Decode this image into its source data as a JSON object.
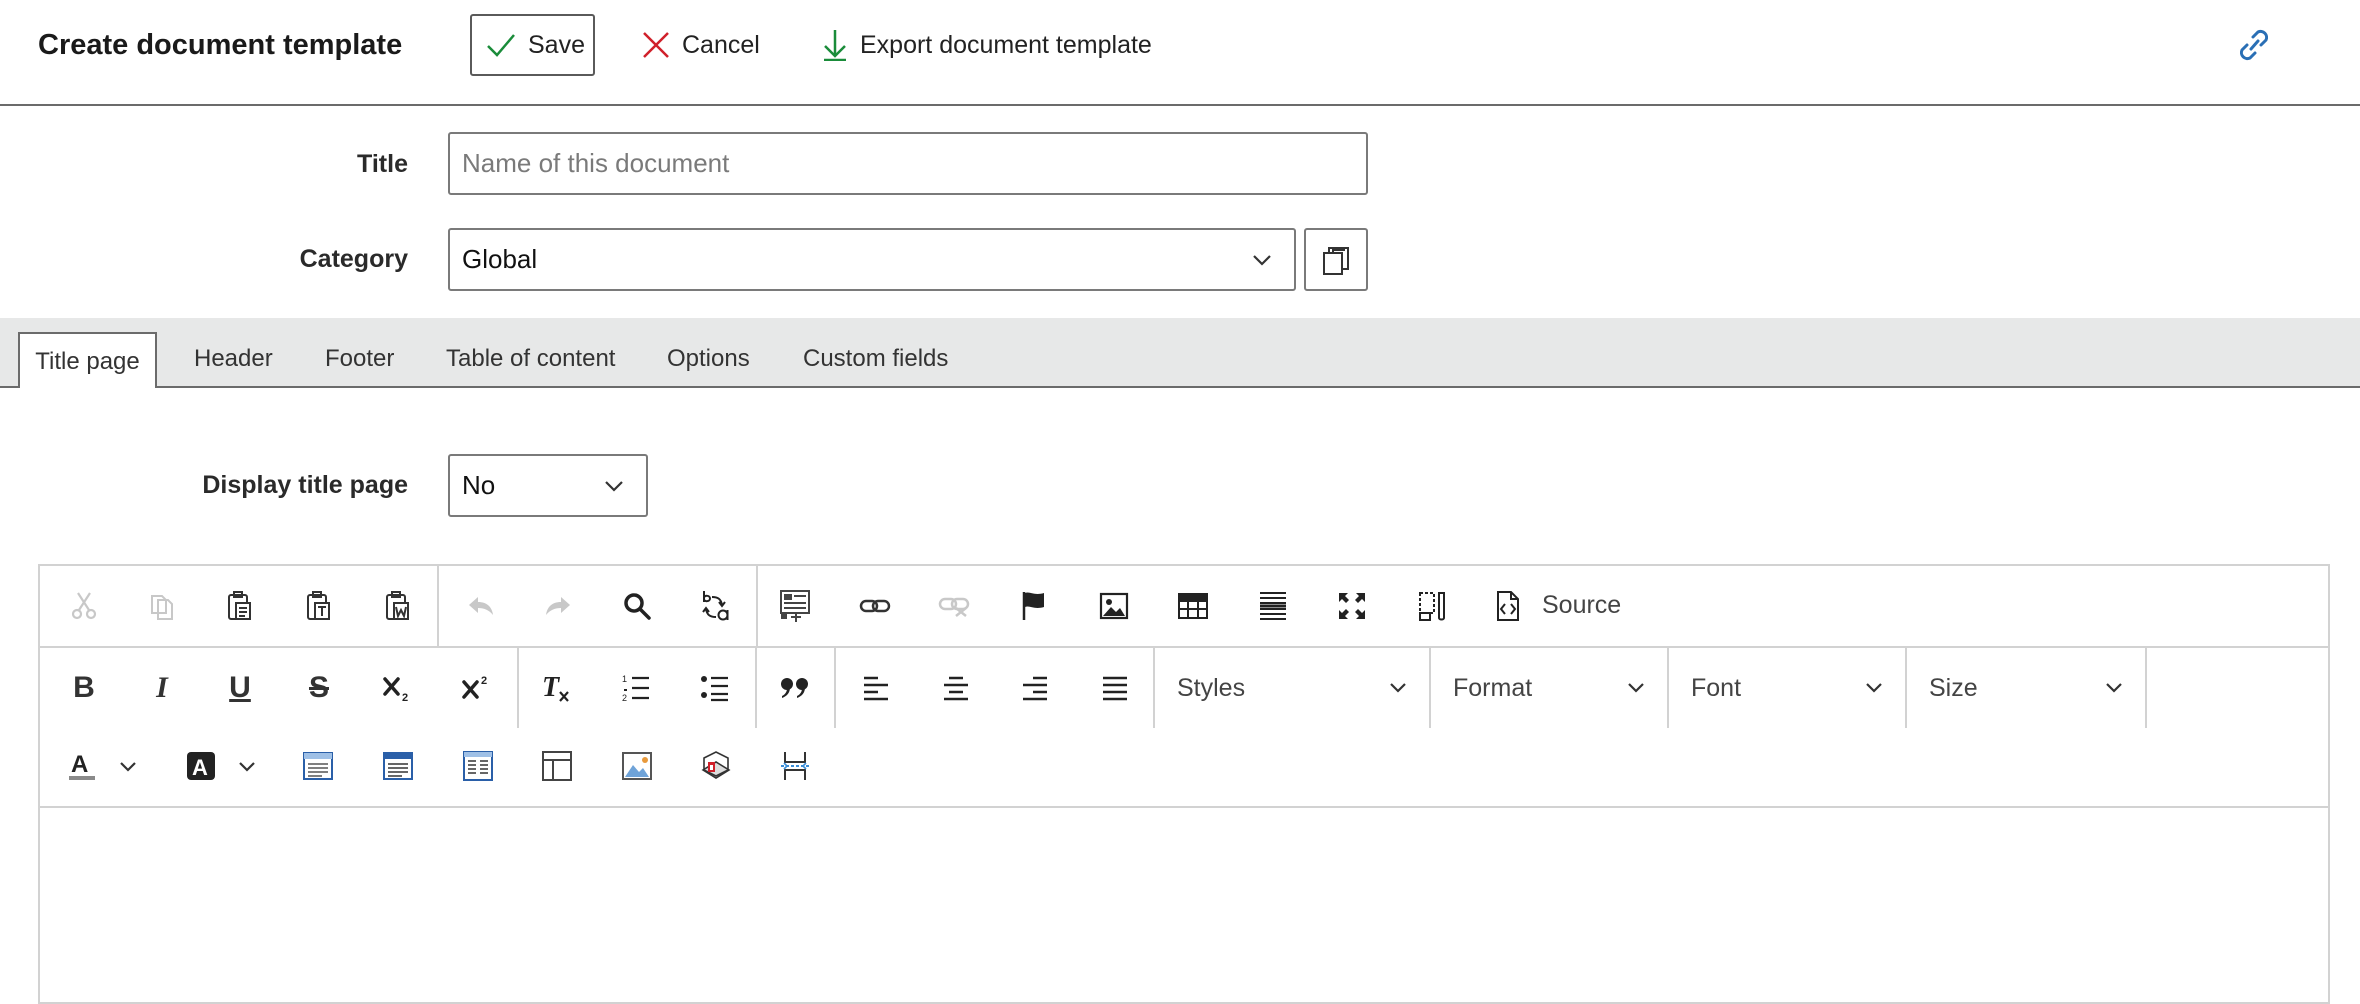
{
  "header": {
    "title": "Create document template",
    "save_label": "Save",
    "cancel_label": "Cancel",
    "export_label": "Export document template"
  },
  "form": {
    "title_label": "Title",
    "title_value": "",
    "title_placeholder": "Name of this document",
    "category_label": "Category",
    "category_value": "Global",
    "display_title_label": "Display title page",
    "display_title_value": "No"
  },
  "tabs": [
    {
      "label": "Title page",
      "active": true
    },
    {
      "label": "Header"
    },
    {
      "label": "Footer"
    },
    {
      "label": "Table of content"
    },
    {
      "label": "Options"
    },
    {
      "label": "Custom fields"
    }
  ],
  "editor": {
    "source_label": "Source",
    "combos": {
      "styles": "Styles",
      "format": "Format",
      "font": "Font",
      "size": "Size"
    },
    "icons_row1": [
      "cut-icon",
      "copy-icon",
      "paste-icon",
      "paste-text-icon",
      "paste-word-icon",
      "undo-icon",
      "redo-icon",
      "find-icon",
      "replace-icon",
      "form-icon",
      "link-icon",
      "unlink-icon",
      "anchor-icon",
      "image-icon",
      "table-icon",
      "horizontal-line-icon",
      "maximize-icon",
      "show-blocks-icon",
      "source-icon"
    ],
    "icons_row2": [
      "bold-icon",
      "italic-icon",
      "underline-icon",
      "strikethrough-icon",
      "subscript-icon",
      "superscript-icon",
      "remove-format-icon",
      "numbered-list-icon",
      "bulleted-list-icon",
      "blockquote-icon",
      "align-left-icon",
      "align-center-icon",
      "align-right-icon",
      "justify-icon"
    ],
    "icons_row3": [
      "text-color-icon",
      "background-color-icon",
      "template-header-icon",
      "template-footer-icon",
      "template-columns-icon",
      "layout-icon",
      "image-placeholder-icon",
      "chart-icon",
      "page-break-icon"
    ]
  },
  "colors": {
    "save_check": "#1a8c3a",
    "cancel_x": "#d0202a",
    "export_arrow": "#1a8c3a",
    "link": "#2a6fb5",
    "tabbar": "#e7e8e8"
  }
}
